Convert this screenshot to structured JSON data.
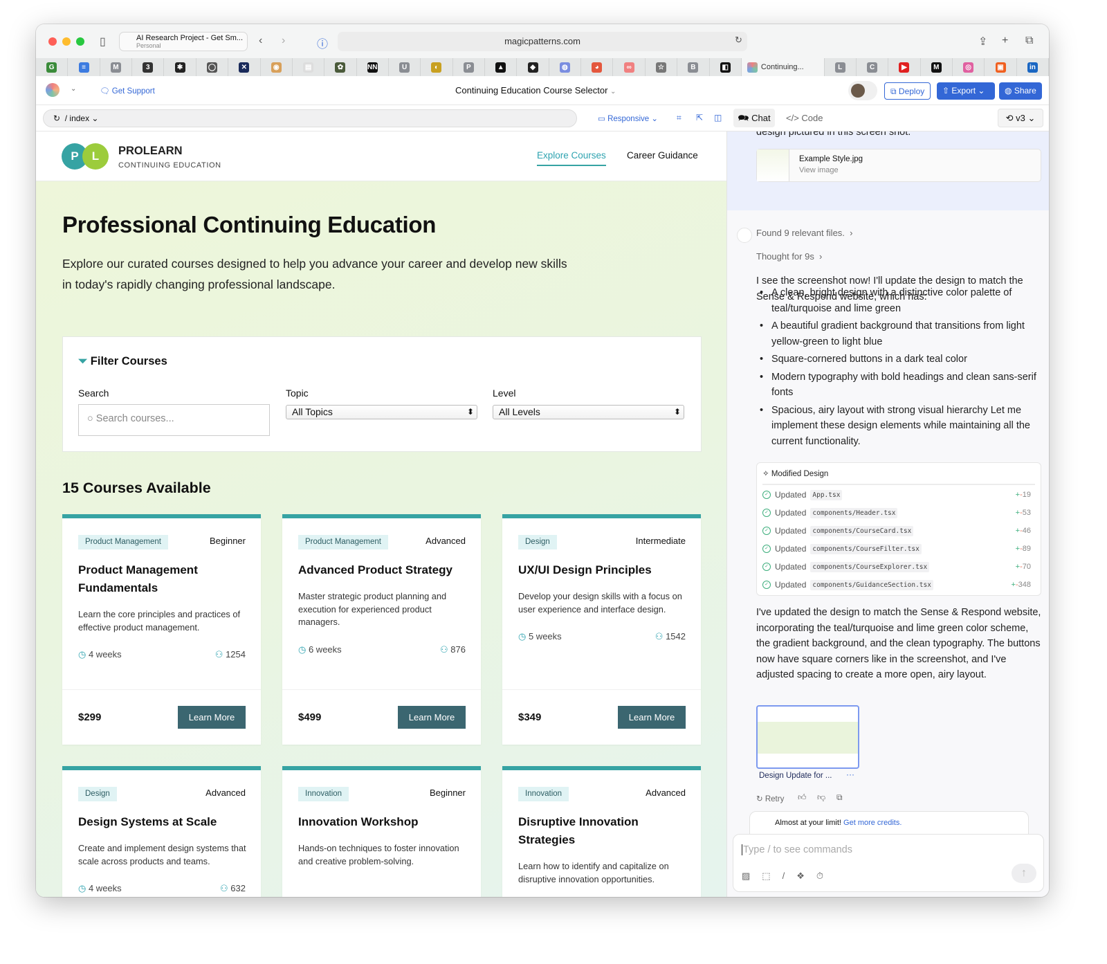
{
  "browser": {
    "profile_name": "AI Research Project - Get Sm...",
    "profile_sub": "Personal",
    "url": "magicpatterns.com",
    "bookmark_tabs": [
      "G",
      "≡",
      "M",
      "3",
      "✱",
      "◯",
      "✕",
      "◉",
      "▤",
      "✿",
      "NN",
      "U",
      "◐",
      "P",
      "▲",
      "◆",
      "◍",
      "◕",
      "∞",
      "☆",
      "B",
      "◧"
    ],
    "active_tab": "Continuing...",
    "right_tabs": [
      "L",
      "C",
      "▶",
      "M",
      "◎",
      "▣",
      "in"
    ]
  },
  "app": {
    "get_support": "Get Support",
    "project_title": "Continuing Education Course Selector",
    "deploy": "Deploy",
    "export": "Export",
    "share": "Share",
    "path": "/ index",
    "responsive": "Responsive",
    "chat_tab": "Chat",
    "code_tab": "Code",
    "version": "v3"
  },
  "site": {
    "logo_p": "P",
    "logo_l": "L",
    "brand": "PROLEARN",
    "brand_sub": "CONTINUING EDUCATION",
    "nav": [
      "Explore Courses",
      "Career Guidance"
    ],
    "hero_title": "Professional Continuing Education",
    "hero_text": "Explore our curated courses designed to help you advance your career and develop new skills in today's rapidly changing professional landscape.",
    "filter": {
      "title": "Filter Courses",
      "search_label": "Search",
      "search_placeholder": "Search courses...",
      "topic_label": "Topic",
      "topic_value": "All Topics",
      "level_label": "Level",
      "level_value": "All Levels"
    },
    "count_title": "15 Courses Available",
    "learn_more": "Learn More",
    "courses": [
      {
        "category": "Product Management",
        "level": "Beginner",
        "title": "Product Management Fundamentals",
        "desc": "Learn the core principles and practices of effective product management.",
        "duration": "4 weeks",
        "students": "1254",
        "price": "$299"
      },
      {
        "category": "Product Management",
        "level": "Advanced",
        "title": "Advanced Product Strategy",
        "desc": "Master strategic product planning and execution for experienced product managers.",
        "duration": "6 weeks",
        "students": "876",
        "price": "$499"
      },
      {
        "category": "Design",
        "level": "Intermediate",
        "title": "UX/UI Design Principles",
        "desc": "Develop your design skills with a focus on user experience and interface design.",
        "duration": "5 weeks",
        "students": "1542",
        "price": "$349"
      },
      {
        "category": "Design",
        "level": "Advanced",
        "title": "Design Systems at Scale",
        "desc": "Create and implement design systems that scale across products and teams.",
        "duration": "4 weeks",
        "students": "632"
      },
      {
        "category": "Innovation",
        "level": "Beginner",
        "title": "Innovation Workshop",
        "desc": "Hands-on techniques to foster innovation and creative problem-solving."
      },
      {
        "category": "Innovation",
        "level": "Advanced",
        "title": "Disruptive Innovation Strategies",
        "desc": "Learn how to identify and capitalize on disruptive innovation opportunities."
      }
    ]
  },
  "chat": {
    "prev_text": "design pictured in this screen shot.",
    "attachment_name": "Example Style.jpg",
    "attachment_action": "View image",
    "found": "Found 9 relevant files.",
    "thought": "Thought for 9s",
    "intro": "I see the screenshot now! I'll update the design to match the Sense & Respond website, which has:",
    "bullets": [
      "A clean, bright design with a distinctive color palette of teal/turquoise and lime green",
      "A beautiful gradient background that transitions from light yellow-green to light blue",
      "Square-cornered buttons in a dark teal color",
      "Modern typography with bold headings and clean sans-serif fonts",
      "Spacious, airy layout with strong visual hierarchy Let me implement these design elements while maintaining all the current functionality."
    ],
    "modified_title": "Modified Design",
    "updated_label": "Updated",
    "files": [
      {
        "path": "App.tsx",
        "n": "19"
      },
      {
        "path": "components/Header.tsx",
        "n": "53"
      },
      {
        "path": "components/CourseCard.tsx",
        "n": "46"
      },
      {
        "path": "components/CourseFilter.tsx",
        "n": "89"
      },
      {
        "path": "components/CourseExplorer.tsx",
        "n": "70"
      },
      {
        "path": "components/GuidanceSection.tsx",
        "n": "348"
      }
    ],
    "summary": "I've updated the design to match the Sense & Respond website, incorporating the teal/turquoise and lime green color scheme, the gradient background, and the clean typography. The buttons now have square corners like in the screenshot, and I've adjusted spacing to create a more open, airy layout.",
    "preview_label": "Design Update for ...",
    "retry": "Retry",
    "limit_text": "Almost at your limit!",
    "limit_link": "Get more credits.",
    "input_placeholder": "Type / to see commands"
  },
  "colors": {
    "teal": "#36a3a3",
    "lime": "#9ccc3c",
    "button": "#3b6670",
    "accent_blue": "#3367d6"
  }
}
